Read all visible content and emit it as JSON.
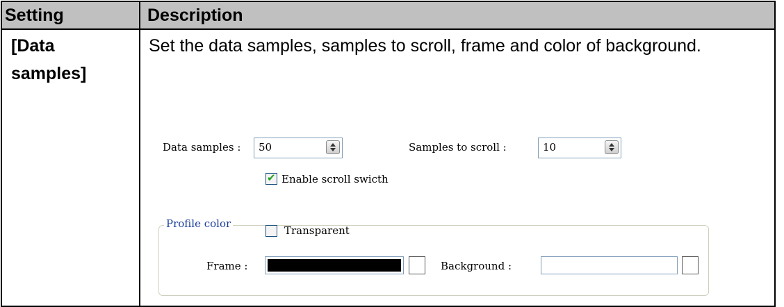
{
  "table": {
    "headers": [
      "Setting",
      "Description"
    ],
    "row": {
      "setting_lines": [
        "[Data",
        "samples]"
      ],
      "description": "Set the data samples, samples to scroll, frame and color of background."
    }
  },
  "dialog": {
    "data_samples_label": "Data samples :",
    "data_samples_value": "50",
    "samples_to_scroll_label": "Samples to scroll  :",
    "samples_to_scroll_value": "10",
    "enable_scroll_label": "Enable scroll swicth",
    "enable_scroll_checked": true,
    "profile_color_title": "Profile color",
    "transparent_label": "Transparent",
    "transparent_checked": false,
    "frame_label": "Frame :",
    "frame_color": "#000000",
    "background_label": "Background :",
    "background_color": "#ffffff"
  }
}
